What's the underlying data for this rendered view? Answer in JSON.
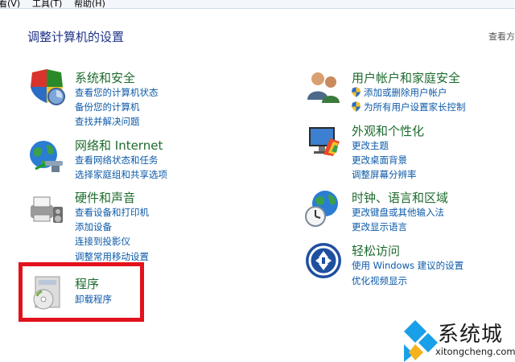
{
  "menubar": {
    "view": "看(V)",
    "tools": "工具(T)",
    "help": "帮助(H)"
  },
  "page_title": "调整计算机的设置",
  "view_by": "查看方",
  "categories": {
    "system": {
      "title": "系统和安全",
      "links": [
        "查看您的计算机状态",
        "备份您的计算机",
        "查找并解决问题"
      ]
    },
    "network": {
      "title": "网络和 Internet",
      "links": [
        "查看网络状态和任务",
        "选择家庭组和共享选项"
      ]
    },
    "hardware": {
      "title": "硬件和声音",
      "links": [
        "查看设备和打印机",
        "添加设备",
        "连接到投影仪",
        "调整常用移动设置"
      ]
    },
    "programs": {
      "title": "程序",
      "links": [
        "卸载程序"
      ]
    },
    "users": {
      "title": "用户帐户和家庭安全",
      "links": [
        "添加或删除用户帐户",
        "为所有用户设置家长控制"
      ]
    },
    "appearance": {
      "title": "外观和个性化",
      "links": [
        "更改主题",
        "更改桌面背景",
        "调整屏幕分辨率"
      ]
    },
    "clock": {
      "title": "时钟、语言和区域",
      "links": [
        "更改键盘或其他输入法",
        "更改显示语言"
      ]
    },
    "ease": {
      "title": "轻松访问",
      "links": [
        "使用 Windows 建议的设置",
        "优化视频显示"
      ]
    }
  },
  "watermark": {
    "text": "系统城",
    "url": "xitongcheng.com"
  }
}
